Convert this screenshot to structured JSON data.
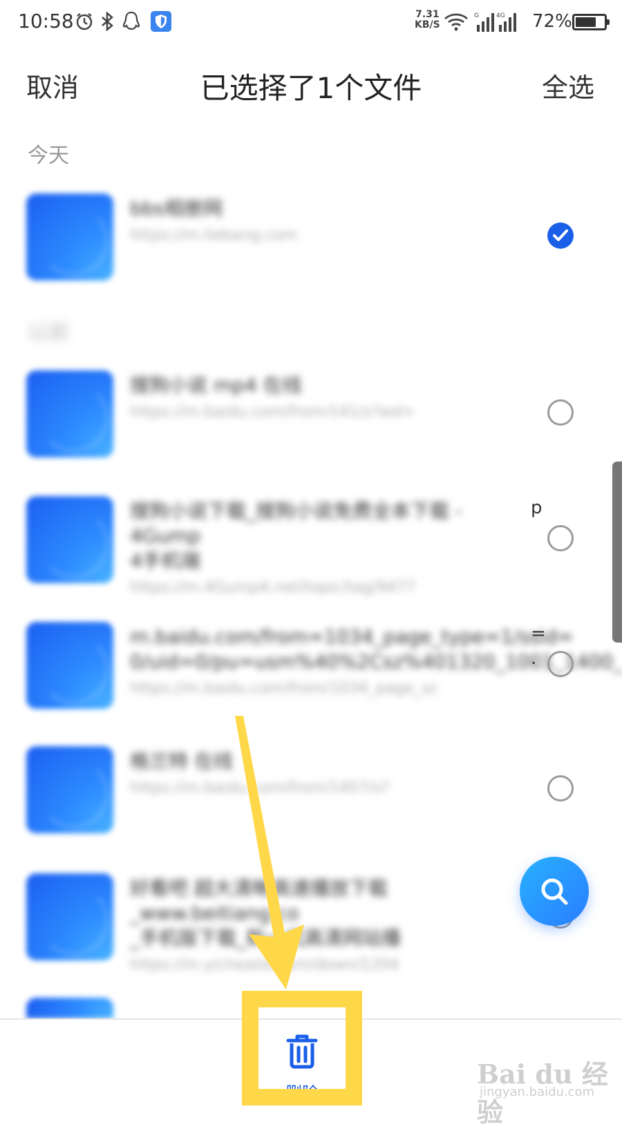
{
  "status_bar": {
    "time": "10:58",
    "net_speed_value": "7.31",
    "net_speed_unit": "KB/S",
    "signal_label_1": "G",
    "signal_label_2": "4G",
    "battery": "72%",
    "battery_level": 0.72
  },
  "header": {
    "cancel": "取消",
    "title": "已选择了1个文件",
    "select_all": "全选"
  },
  "sections": {
    "today": "今天",
    "earlier": "以前"
  },
  "items": [
    {
      "title": "bbs相册网",
      "url": "https://m.liebang.com",
      "checked": true
    },
    {
      "title": "搜狗小说 mp4 在线",
      "url": "https://m.baidu.com/from/141/s?wd=",
      "checked": false
    },
    {
      "title": "搜狗小说下载_搜狗小说免费全本下载 - 4Gump",
      "title_edge": "p",
      "title2": "4手机端",
      "url": "https://m.4Gump4.net/topic/tag/9477",
      "checked": false
    },
    {
      "title": "m.baidu.com/from=1034_page_type=1/ssid=",
      "title_edge": "=",
      "title2": "0/uid=0/pu=usm%40%2Csz%401320_1001_1400_",
      "title2_edge": ".",
      "url": "https://m.baidu.com/from/1034_page_sz",
      "checked": false
    },
    {
      "title": "格兰特 在线",
      "url": "https://m.baidu.com/from/1457/s?",
      "checked": false
    },
    {
      "title": "好看吧 超大清晰高速播放下载_www.beitiang.co",
      "title2": "_手机版下载_新一代高清网站播",
      "url": "https://m.yicheaila.com/down/1204",
      "checked": false
    }
  ],
  "bottom_bar": {
    "delete_label": "删除"
  },
  "watermark": {
    "logo": "Bai du 经验",
    "sub": "jingyan.baidu.com"
  },
  "colors": {
    "accent": "#1a5fe8",
    "highlight": "#ffd84a",
    "thumb": "#2d8bff"
  }
}
